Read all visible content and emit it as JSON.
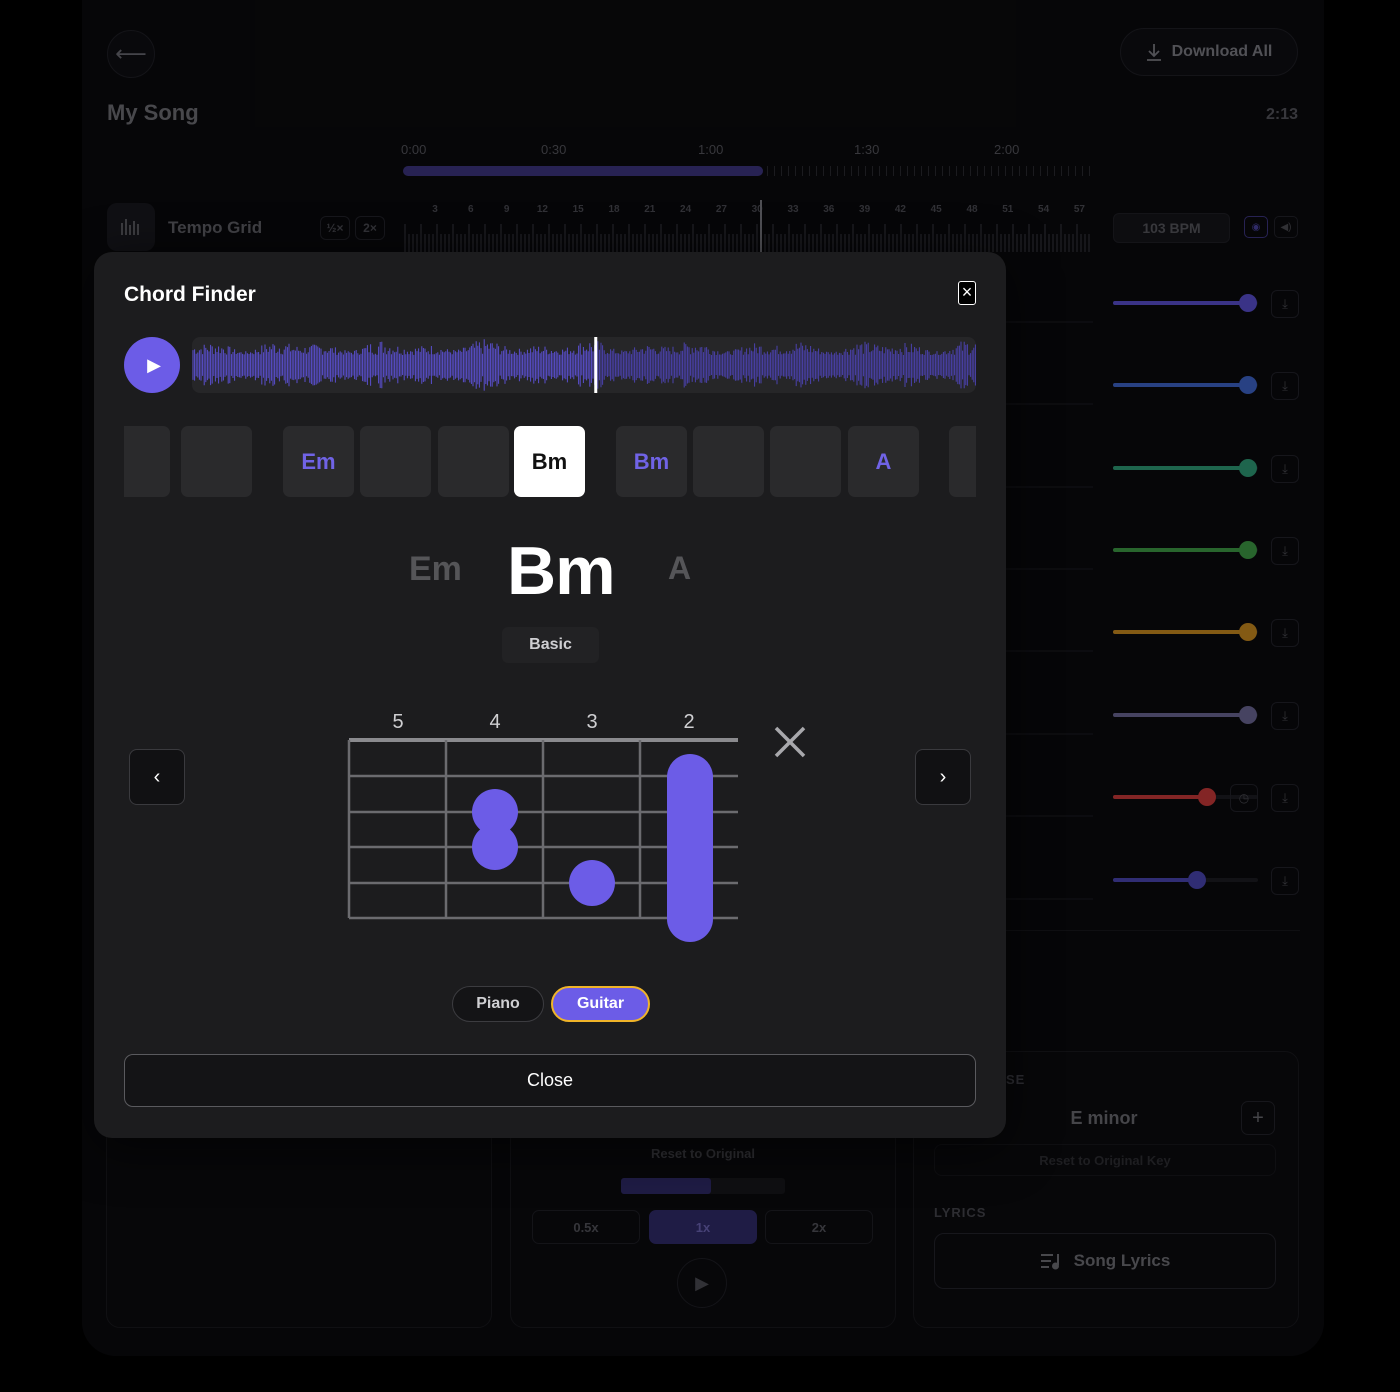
{
  "app": {
    "title": "My Song",
    "duration": "2:13",
    "download_all": "Download All",
    "timeline": {
      "labels": [
        "0:00",
        "0:30",
        "1:00",
        "1:30",
        "2:00"
      ],
      "progress_fraction": 0.52
    },
    "tempo": {
      "label": "Tempo Grid",
      "half": "½×",
      "double": "2×",
      "bpm": "103 BPM",
      "beat_numbers": [
        "3",
        "6",
        "9",
        "12",
        "15",
        "18",
        "21",
        "24",
        "27",
        "30",
        "33",
        "36",
        "39",
        "42",
        "45",
        "48",
        "51",
        "54",
        "57"
      ]
    },
    "tracks": [
      {
        "color": "#5a4fcf",
        "level": 0.93
      },
      {
        "color": "#3e64c9",
        "level": 0.93
      },
      {
        "color": "#2f9c77",
        "level": 0.93
      },
      {
        "color": "#3e9b45",
        "level": 0.93
      },
      {
        "color": "#c98a20",
        "level": 0.93
      },
      {
        "color": "#6c6895",
        "level": 0.93
      },
      {
        "color": "#c93a3a",
        "level": 0.65
      },
      {
        "color": "#4b45b3",
        "level": 0.58
      }
    ],
    "speed_panel": {
      "reset": "Reset to Original",
      "level": 0.55,
      "options": [
        "0.5x",
        "1x",
        "2x"
      ],
      "active": "1x"
    },
    "key_panel": {
      "label": "SE",
      "value": "E minor",
      "reset": "Reset to Original Key",
      "lyrics_label": "LYRICS",
      "lyrics_button": "Song Lyrics"
    }
  },
  "modal": {
    "title": "Chord Finder",
    "playhead_fraction": 0.515,
    "chord_cells": [
      "",
      "",
      "Em",
      "",
      "",
      "Bm",
      "Bm",
      "",
      "",
      "A",
      ""
    ],
    "active_cell_index": 5,
    "previous_chord": "Em",
    "current_chord": "Bm",
    "next_chord": "A",
    "variation": "Basic",
    "diagram": {
      "fret_labels": [
        "5",
        "4",
        "3",
        "2"
      ],
      "muted_string_marker": "×"
    },
    "instruments": [
      "Piano",
      "Guitar"
    ],
    "active_instrument": "Guitar",
    "close_label": "Close",
    "accent": "#6c5ce7"
  }
}
